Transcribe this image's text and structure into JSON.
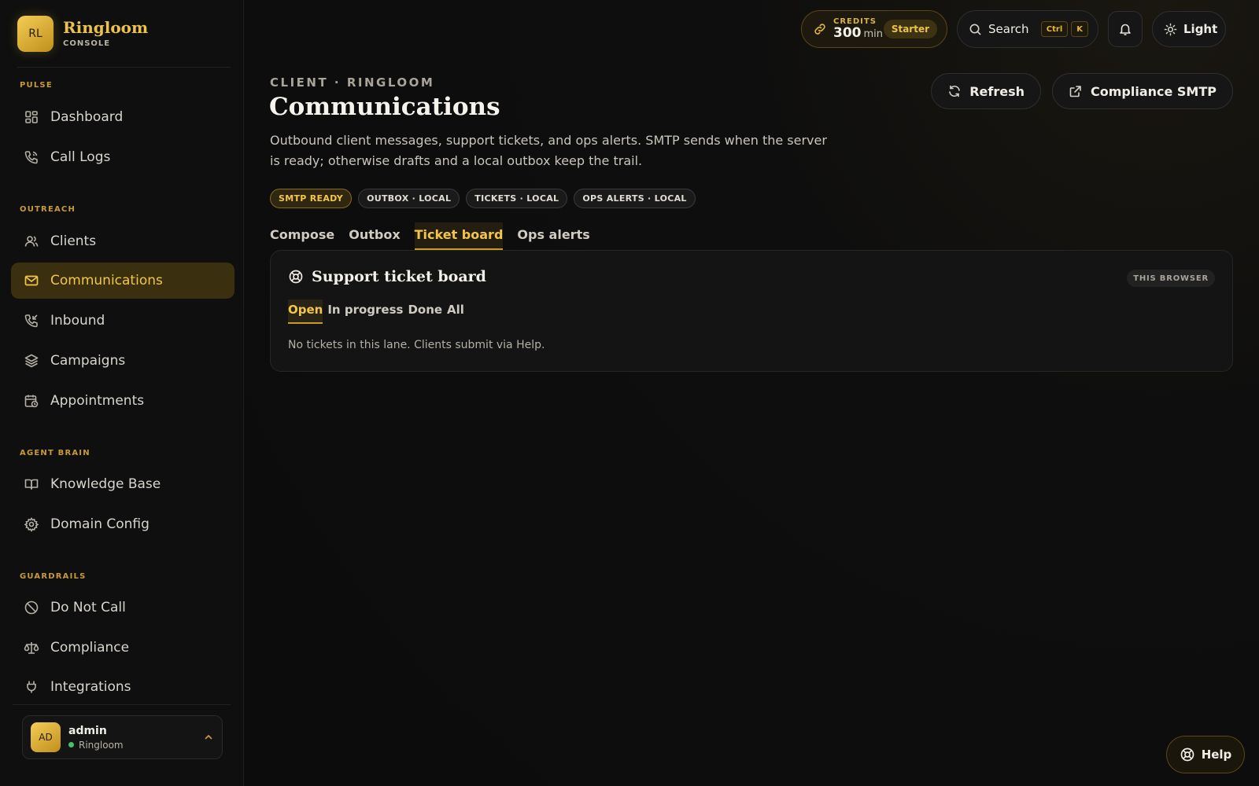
{
  "brand": {
    "logo": "RL",
    "name": "Ringloom",
    "subtitle": "CONSOLE"
  },
  "sidebar": {
    "sections": [
      {
        "label": "PULSE",
        "items": [
          {
            "label": "Dashboard",
            "icon": "grid-icon"
          },
          {
            "label": "Call Logs",
            "icon": "phone-icon"
          }
        ]
      },
      {
        "label": "OUTREACH",
        "items": [
          {
            "label": "Clients",
            "icon": "users-icon"
          },
          {
            "label": "Communications",
            "icon": "mail-icon",
            "active": true
          },
          {
            "label": "Inbound",
            "icon": "phone-incoming-icon"
          },
          {
            "label": "Campaigns",
            "icon": "layers-icon"
          },
          {
            "label": "Appointments",
            "icon": "calendar-clock-icon"
          }
        ]
      },
      {
        "label": "AGENT BRAIN",
        "items": [
          {
            "label": "Knowledge Base",
            "icon": "book-icon"
          },
          {
            "label": "Domain Config",
            "icon": "gear-icon"
          }
        ]
      },
      {
        "label": "GUARDRAILS",
        "items": [
          {
            "label": "Do Not Call",
            "icon": "ban-icon"
          },
          {
            "label": "Compliance",
            "icon": "scale-icon"
          },
          {
            "label": "Integrations",
            "icon": "plug-icon"
          }
        ]
      }
    ]
  },
  "user": {
    "initials": "AD",
    "name": "admin",
    "org": "Ringloom"
  },
  "topbar": {
    "credits_label": "CREDITS",
    "credits_value": "300",
    "credits_unit": "min",
    "plan": "Starter",
    "search_label": "Search",
    "kbd_1": "Ctrl",
    "kbd_2": "K",
    "theme_label": "Light"
  },
  "header": {
    "eyebrow": "CLIENT · RINGLOOM",
    "title": "Communications",
    "description": "Outbound client messages, support tickets, and ops alerts. SMTP sends when the server is ready; otherwise drafts and a local outbox keep the trail.",
    "refresh_label": "Refresh",
    "compliance_label": "Compliance SMTP"
  },
  "badges": [
    "SMTP READY",
    "OUTBOX · LOCAL",
    "TICKETS · LOCAL",
    "OPS ALERTS · LOCAL"
  ],
  "tabs": [
    "Compose",
    "Outbox",
    "Ticket board",
    "Ops alerts"
  ],
  "ticket_board": {
    "title": "Support ticket board",
    "scope": "THIS BROWSER",
    "lanes": [
      "Open",
      "In progress",
      "Done",
      "All"
    ],
    "empty_text": "No tickets in this lane. Clients submit via Help."
  },
  "help_label": "Help",
  "colors": {
    "accent": "#f3c64a",
    "active_bg": "#3a2f0f",
    "background": "#0d0d0d",
    "online": "#3ec46d"
  }
}
